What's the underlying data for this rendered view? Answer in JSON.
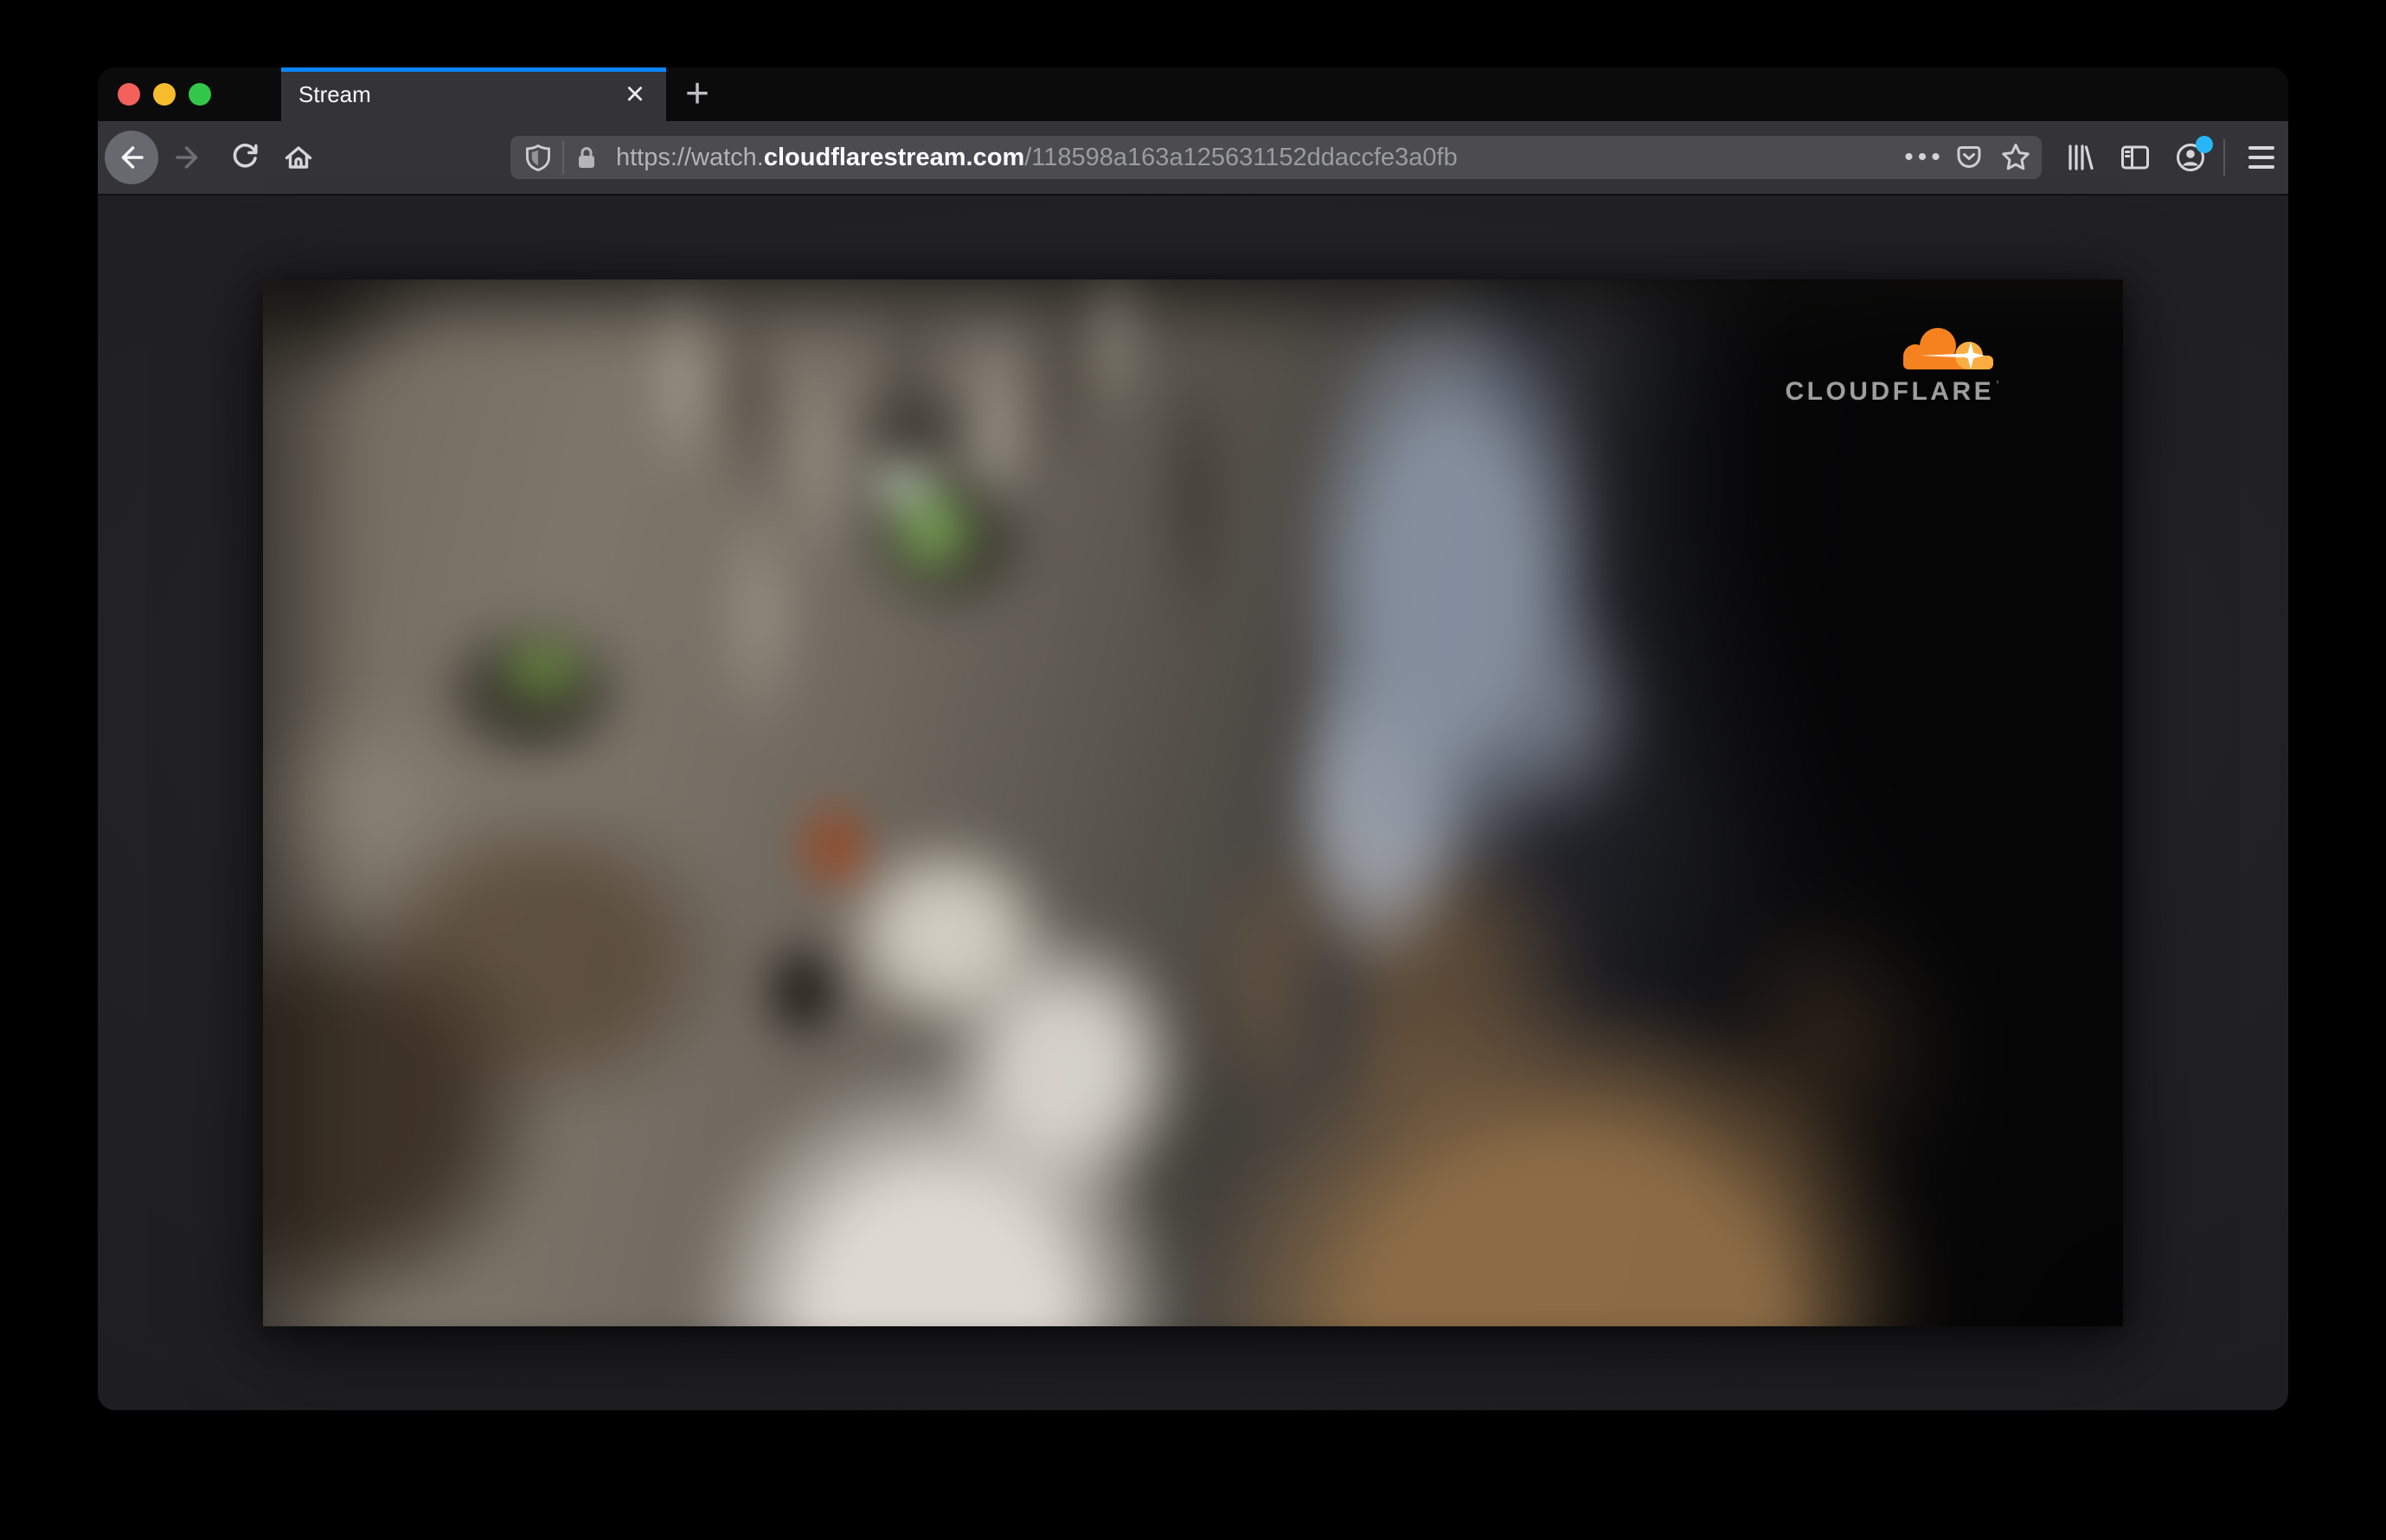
{
  "browser": {
    "tab": {
      "title": "Stream",
      "close_glyph": "×"
    },
    "new_tab_glyph": "+",
    "address_bar": {
      "prefix": "https://watch.",
      "domain": "cloudflarestream.com",
      "path": "/118598a163a125631152ddaccfe3a0fb",
      "page_actions_glyph": "•••"
    }
  },
  "content": {
    "brand_wordmark": "CLOUDFLARE",
    "brand_trademark": "’"
  },
  "colors": {
    "tab_accent": "#0a84ff",
    "notification_badge": "#29b6f6",
    "cloudflare_orange": "#f6821f",
    "cloudflare_orange_light": "#fbad41",
    "traffic_close": "#f4605a",
    "traffic_minimize": "#f8bd2d",
    "traffic_zoom": "#34c84a"
  }
}
